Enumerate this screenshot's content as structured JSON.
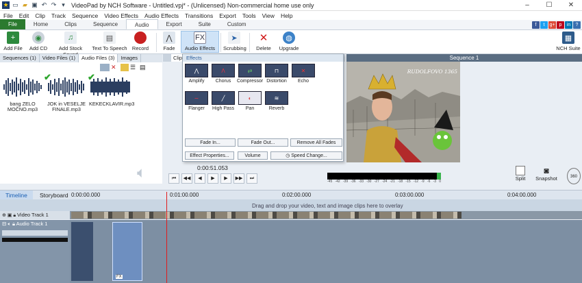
{
  "window": {
    "title": "VideoPad by NCH Software - Untitled.vpj* - (Unlicensed) Non-commercial home use only"
  },
  "menu": [
    "File",
    "Edit",
    "Clip",
    "Track",
    "Sequence",
    "Video Effects",
    "Audio Effects",
    "Transitions",
    "Export",
    "Tools",
    "View",
    "Help"
  ],
  "tabs": [
    "File",
    "Home",
    "Clips",
    "Sequence",
    "Audio",
    "Export",
    "Suite",
    "Custom"
  ],
  "active_tab": "Audio",
  "social": [
    "f",
    "t",
    "g+",
    "p",
    "in",
    "?"
  ],
  "ribbon": {
    "add_file": "Add File",
    "add_cd": "Add CD",
    "add_stock_sound": "Add Stock Sound",
    "text_to_speech": "Text To Speech",
    "record": "Record",
    "fade": "Fade",
    "audio_effects": "Audio Effects",
    "scrubbing": "Scrubbing",
    "delete": "Delete",
    "upgrade": "Upgrade",
    "nch_suite": "NCH Suite"
  },
  "bin_tabs": [
    {
      "label": "Sequences",
      "count": "1"
    },
    {
      "label": "Video Files",
      "count": "1"
    },
    {
      "label": "Audio Files",
      "count": "3"
    },
    {
      "label": "Images",
      "count": ""
    }
  ],
  "audio_files": [
    {
      "name": "bang ZELO MOČNO.mp3",
      "checked": false
    },
    {
      "name": "JOK in VESELJE FINALE.mp3",
      "checked": true
    },
    {
      "name": "KEKECKLAVIR.mp3",
      "checked": true
    }
  ],
  "effects_popup": {
    "header": "Effects",
    "items": [
      "Amplify",
      "Chorus",
      "Compressor",
      "Distortion",
      "Echo",
      "Flanger",
      "High Pass",
      "Pan",
      "Reverb"
    ],
    "fade_in": "Fade In...",
    "fade_out": "Fade Out...",
    "remove_all_fades": "Remove All Fades",
    "effect_properties": "Effect Properties...",
    "volume": "Volume",
    "speed_change": "Speed Change..."
  },
  "preview": {
    "sequence_title": "Sequence 1",
    "clip_tab_label": "Clip",
    "time": "0:00:51.053",
    "caption": "RUDOLFOVO 1365",
    "meter_scale": [
      "-45",
      "-42",
      "-39",
      "-36",
      "-33",
      "-30",
      "-27",
      "-24",
      "-21",
      "-18",
      "-15",
      "-12",
      "-9",
      "-6",
      "-3",
      "0"
    ],
    "split": "Split",
    "snapshot": "Snapshot",
    "three_sixty": "360"
  },
  "timeline": {
    "tabs": [
      "Timeline",
      "Storyboard"
    ],
    "ruler": [
      "0:00:00.000",
      "0:01:00.000",
      "0:02:00.000",
      "0:03:00.000",
      "0:04:00.000"
    ],
    "overlay_hint": "Drag and drop your video, text and image clips here to overlay",
    "video_track": "Video Track 1",
    "audio_track": "Audio Track 1"
  }
}
